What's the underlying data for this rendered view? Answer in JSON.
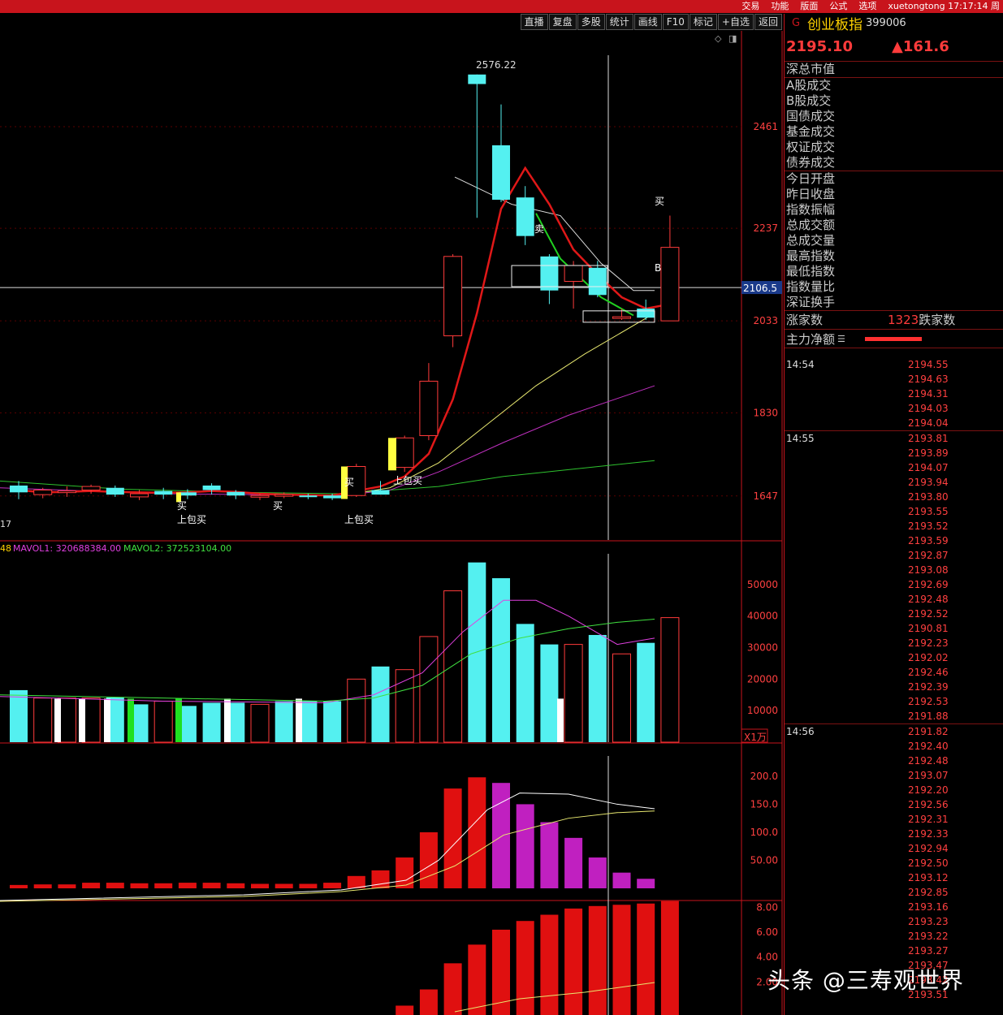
{
  "menu": [
    "交易",
    "功能",
    "版面",
    "公式",
    "选项",
    "xuetongtong 17:17:14 周"
  ],
  "toolbar": [
    "直播",
    "复盘",
    "多股",
    "统计",
    "画线",
    "F10",
    "标记",
    "+自选",
    "返回"
  ],
  "header": {
    "mark": "G",
    "name": "创业板指",
    "code": "399006",
    "price": "2195.10",
    "change": "▲161.6"
  },
  "info_rows_1": [
    "深总市值"
  ],
  "info_rows_2": [
    "A股成交",
    "B股成交",
    "国债成交",
    "基金成交",
    "权证成交",
    "债券成交"
  ],
  "info_rows_3": [
    "今日开盘",
    "昨日收盘",
    "指数振幅",
    "总成交额",
    "总成交量",
    "最高指数",
    "最低指数",
    "指数量比",
    "深证换手"
  ],
  "updown": {
    "label": "涨家数",
    "value": "1323",
    "label2": "跌家数"
  },
  "flow_label": "主力净额",
  "ticks": [
    {
      "time": "14:54",
      "prices": [
        "2194.55",
        "2194.63",
        "2194.31",
        "2194.03",
        "2194.04"
      ]
    },
    {
      "time": "14:55",
      "prices": [
        "2193.81",
        "2193.89",
        "2194.07",
        "2193.94",
        "2193.80",
        "2193.55",
        "2193.52",
        "2193.59",
        "2192.87",
        "2193.08",
        "2192.69",
        "2192.48",
        "2192.52",
        "2190.81",
        "2192.23",
        "2192.02",
        "2192.46",
        "2192.39",
        "2192.53",
        "2191.88"
      ]
    },
    {
      "time": "14:56",
      "prices": [
        "2191.82",
        "2192.40",
        "2192.48",
        "2193.07",
        "2192.20",
        "2192.56",
        "2192.31",
        "2192.33",
        "2192.94",
        "2192.50",
        "2193.12",
        "2192.85",
        "2193.16",
        "2193.23",
        "2193.22",
        "2193.27",
        "2193.47",
        "2193.42",
        "2193.51"
      ]
    }
  ],
  "watermark": "头条 @三寿观世界",
  "chart_data": {
    "type": "candlestick",
    "price_axis_labels": [
      "2461",
      "2237",
      "2106.5",
      "2033",
      "1830",
      "1647"
    ],
    "max_label": "2576.22",
    "left_label": "17",
    "signals": [
      "买",
      "上包买",
      "买",
      "上包买",
      "买",
      "上包买",
      "卖",
      "买",
      "B"
    ],
    "candles": [
      {
        "o": 1655,
        "c": 1670,
        "h": 1680,
        "l": 1640,
        "up": false
      },
      {
        "o": 1650,
        "c": 1660,
        "h": 1665,
        "l": 1642,
        "up": true
      },
      {
        "o": 1655,
        "c": 1658,
        "h": 1668,
        "l": 1645,
        "up": true
      },
      {
        "o": 1668,
        "c": 1660,
        "h": 1672,
        "l": 1652,
        "up": true
      },
      {
        "o": 1665,
        "c": 1650,
        "h": 1670,
        "l": 1645,
        "up": false
      },
      {
        "o": 1645,
        "c": 1652,
        "h": 1660,
        "l": 1638,
        "up": true
      },
      {
        "o": 1650,
        "c": 1658,
        "h": 1665,
        "l": 1640,
        "up": false
      },
      {
        "o": 1655,
        "c": 1648,
        "h": 1662,
        "l": 1640,
        "up": false
      },
      {
        "o": 1660,
        "c": 1670,
        "h": 1675,
        "l": 1650,
        "up": false
      },
      {
        "o": 1656,
        "c": 1648,
        "h": 1660,
        "l": 1640,
        "up": false
      },
      {
        "o": 1648,
        "c": 1646,
        "h": 1652,
        "l": 1638,
        "up": true
      },
      {
        "o": 1648,
        "c": 1650,
        "h": 1655,
        "l": 1642,
        "up": true
      },
      {
        "o": 1648,
        "c": 1646,
        "h": 1652,
        "l": 1640,
        "up": false
      },
      {
        "o": 1642,
        "c": 1648,
        "h": 1652,
        "l": 1638,
        "up": false
      },
      {
        "o": 1648,
        "c": 1712,
        "h": 1718,
        "l": 1645,
        "up": true
      },
      {
        "o": 1650,
        "c": 1660,
        "h": 1680,
        "l": 1650,
        "up": false
      },
      {
        "o": 1710,
        "c": 1775,
        "h": 1780,
        "l": 1700,
        "up": true
      },
      {
        "o": 1780,
        "c": 1900,
        "h": 1940,
        "l": 1770,
        "up": true
      },
      {
        "o": 2000,
        "c": 2175,
        "h": 2180,
        "l": 1975,
        "up": true
      },
      {
        "o": 2576,
        "c": 2555,
        "h": 2576,
        "l": 2260,
        "up": false
      },
      {
        "o": 2420,
        "c": 2300,
        "h": 2510,
        "l": 2295,
        "up": false
      },
      {
        "o": 2305,
        "c": 2220,
        "h": 2330,
        "l": 2200,
        "up": false
      },
      {
        "o": 2175,
        "c": 2100,
        "h": 2180,
        "l": 2070,
        "up": false
      },
      {
        "o": 2120,
        "c": 2155,
        "h": 2165,
        "l": 2060,
        "up": true
      },
      {
        "o": 2150,
        "c": 2090,
        "h": 2165,
        "l": 2085,
        "up": false
      },
      {
        "o": 2040,
        "c": 2042,
        "h": 2060,
        "l": 2035,
        "up": true
      },
      {
        "o": 2060,
        "c": 2040,
        "h": 2080,
        "l": 2035,
        "up": false
      },
      {
        "o": 2033,
        "c": 2195,
        "h": 2265,
        "l": 2033,
        "up": true
      }
    ],
    "ma5": [
      1660,
      1655,
      1656,
      1658,
      1656,
      1655,
      1654,
      1655,
      1658,
      1656,
      1652,
      1650,
      1649,
      1648,
      1658,
      1668,
      1690,
      1740,
      1860,
      2050,
      2280,
      2370,
      2290,
      2190,
      2135,
      2085,
      2060,
      2070
    ],
    "ma10": [
      1658,
      1656,
      1656,
      1656,
      1656,
      1655,
      1655,
      1655,
      1655,
      1655,
      1654,
      1652,
      1650,
      1649,
      1652,
      1656,
      1665,
      1685,
      1740,
      1850,
      1990,
      2110,
      2180,
      2210,
      2220,
      2120,
      2060,
      2060
    ],
    "vol_legend": [
      "48",
      "MAVOL1: 320688384.00",
      "MAVOL2: 372523104.00"
    ],
    "vol_axis_labels": [
      "50000",
      "40000",
      "30000",
      "20000",
      "10000"
    ],
    "vol_unit": "X1万",
    "volumes": [
      16500,
      14000,
      14000,
      14000,
      14200,
      12000,
      13000,
      11500,
      12500,
      12500,
      12000,
      13000,
      13000,
      13000,
      20000,
      24000,
      23000,
      33500,
      48000,
      57000,
      52000,
      37500,
      31000,
      31000,
      34000,
      28000,
      31500,
      39500
    ],
    "vol_up": [
      false,
      true,
      true,
      true,
      false,
      false,
      true,
      false,
      false,
      false,
      true,
      false,
      false,
      false,
      true,
      false,
      true,
      true,
      true,
      false,
      false,
      false,
      false,
      true,
      false,
      true,
      false,
      true
    ],
    "ind1_axis_labels": [
      "200.0",
      "150.0",
      "100.0",
      "50.00"
    ],
    "ind1": [
      6,
      7,
      7,
      10,
      10,
      9,
      9,
      10,
      10,
      9,
      8,
      8,
      8,
      10,
      22,
      32,
      55,
      100,
      178,
      198,
      188,
      150,
      118,
      90,
      55,
      28,
      17
    ],
    "ind2_axis_labels": [
      "8.00",
      "6.00",
      "4.00",
      "2.00"
    ],
    "ind2": [
      0,
      0,
      0,
      0,
      0,
      0,
      0,
      0,
      0,
      0,
      0,
      0,
      0,
      0,
      0,
      0,
      0.1,
      1.4,
      3.5,
      5.0,
      6.2,
      6.9,
      7.4,
      7.9,
      8.1,
      8.2,
      8.3,
      8.5
    ]
  }
}
